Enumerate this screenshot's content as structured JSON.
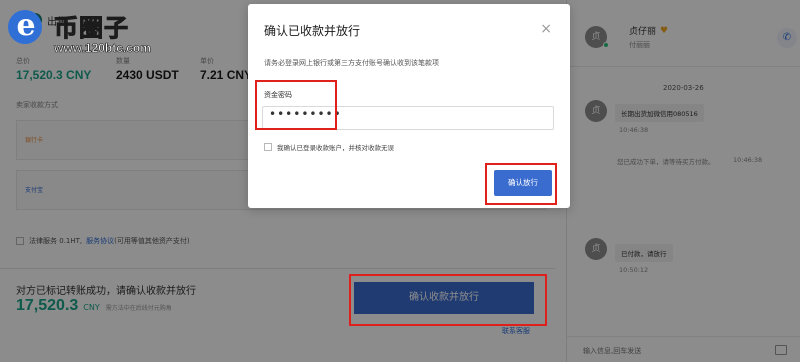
{
  "logo": {
    "title": "币圈子",
    "url": "www.120btc.com",
    "letter": "e"
  },
  "order": {
    "title": "出售",
    "icon": "T",
    "stats": [
      {
        "label": "总价",
        "value": "17,520.3 CNY"
      },
      {
        "label": "数量",
        "value": "2430 USDT"
      },
      {
        "label": "单价",
        "value": "7.21 CNY"
      }
    ],
    "payment_title": "卖家收款方式",
    "payment_methods": [
      "银行卡",
      "支付宝"
    ],
    "service_text": "法律服务 0.1HT,",
    "service_link": "服务协议",
    "service_note": "(可用等值其他资产支付)",
    "status_text": "对方已标记转账成功，请确认收款并放行",
    "amount": "17,520.3",
    "currency": "CNY",
    "amount_note": "需方法中在后线付元购角",
    "confirm_button": "确认收款并放行",
    "contact_link": "联系客服"
  },
  "chat": {
    "avatar_char": "贞",
    "name": "贞仔丽",
    "sub": "付丽丽",
    "date": "2020-03-26",
    "messages": [
      {
        "text": "长期出货加微信用080516",
        "time": "10:46:38"
      },
      {
        "text": "已付款，请放行",
        "time": "10:50:12"
      }
    ],
    "system_text": "您已成功下单，请等待买方付款。",
    "system_time": "10:46:38",
    "input_placeholder": "输入信息,回车发送"
  },
  "modal": {
    "title": "确认已收款并放行",
    "close": "×",
    "description": "请务必登录网上银行或第三方支付账号确认收到该笔款项",
    "password_label": "资金密码",
    "password_value": "•••••••••",
    "agree_text": "我确认已登录收款账户，并核对收款无误",
    "confirm_button": "确认放行"
  },
  "colors": {
    "accent": "#3a6cd0",
    "green": "#1aa58a",
    "highlight": "#e0211b"
  }
}
